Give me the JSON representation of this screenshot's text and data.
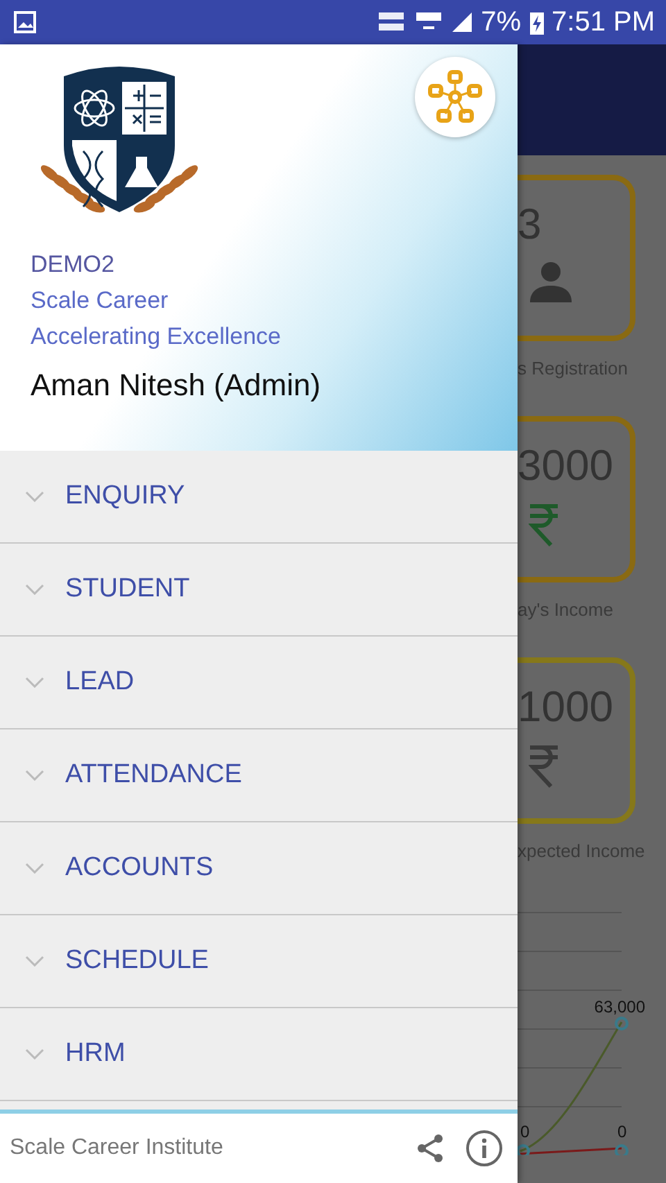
{
  "status_bar": {
    "battery": "7%",
    "time": "7:51 PM"
  },
  "background_screen": {
    "cards": [
      {
        "value": "3",
        "kind": "count",
        "label": "s Registration"
      },
      {
        "value": "3000",
        "kind": "money",
        "label": "ay's Income"
      },
      {
        "value": "1000",
        "kind": "money",
        "label": "xpected Income"
      }
    ],
    "chart_labels": [
      "63,000",
      "0",
      "0"
    ]
  },
  "drawer": {
    "header": {
      "code": "DEMO2",
      "institute": "Scale Career",
      "tagline": "Accelerating Excellence",
      "user": "Aman Nitesh (Admin)"
    },
    "menu": [
      {
        "label": "ENQUIRY",
        "expanded": false
      },
      {
        "label": "STUDENT",
        "expanded": false
      },
      {
        "label": "LEAD",
        "expanded": false
      },
      {
        "label": "ATTENDANCE",
        "expanded": false
      },
      {
        "label": "ACCOUNTS",
        "expanded": false
      },
      {
        "label": "SCHEDULE",
        "expanded": false
      },
      {
        "label": "HRM",
        "expanded": false
      }
    ],
    "footer": {
      "text": "Scale Career Institute"
    }
  }
}
